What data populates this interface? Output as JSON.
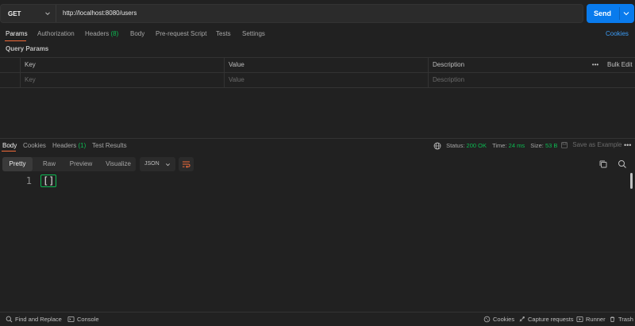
{
  "request": {
    "method": "GET",
    "url": "http://localhost:8080/users",
    "send_label": "Send"
  },
  "request_tabs": [
    {
      "label": "Params",
      "active": true
    },
    {
      "label": "Authorization"
    },
    {
      "label": "Headers",
      "count": "(8)"
    },
    {
      "label": "Body"
    },
    {
      "label": "Pre-request Script"
    },
    {
      "label": "Tests"
    },
    {
      "label": "Settings"
    }
  ],
  "cookies_link": "Cookies",
  "query_params": {
    "title": "Query Params",
    "headers": {
      "key": "Key",
      "value": "Value",
      "description": "Description",
      "more": "•••",
      "bulk_edit": "Bulk Edit"
    },
    "placeholders": {
      "key": "Key",
      "value": "Value",
      "description": "Description"
    }
  },
  "response_tabs": [
    {
      "label": "Body",
      "active": true
    },
    {
      "label": "Cookies"
    },
    {
      "label": "Headers",
      "count": "(1)"
    },
    {
      "label": "Test Results"
    }
  ],
  "response_status": {
    "status_label": "Status:",
    "status_value": "200 OK",
    "time_label": "Time:",
    "time_value": "24 ms",
    "size_label": "Size:",
    "size_value": "53 B",
    "save_example": "Save as Example",
    "more": "•••"
  },
  "format_bar": {
    "modes": [
      "Pretty",
      "Raw",
      "Preview",
      "Visualize"
    ],
    "active_mode": "Pretty",
    "language": "JSON"
  },
  "response_body": {
    "line_number": "1",
    "content": "[]"
  },
  "footer": {
    "find_replace": "Find and Replace",
    "console": "Console",
    "cookies": "Cookies",
    "capture": "Capture requests",
    "runner": "Runner",
    "trash": "Trash"
  },
  "colors": {
    "accent": "#097bed",
    "tab_active": "#f26b3a",
    "status_ok": "#0cbb52",
    "link": "#3b9cf7"
  }
}
